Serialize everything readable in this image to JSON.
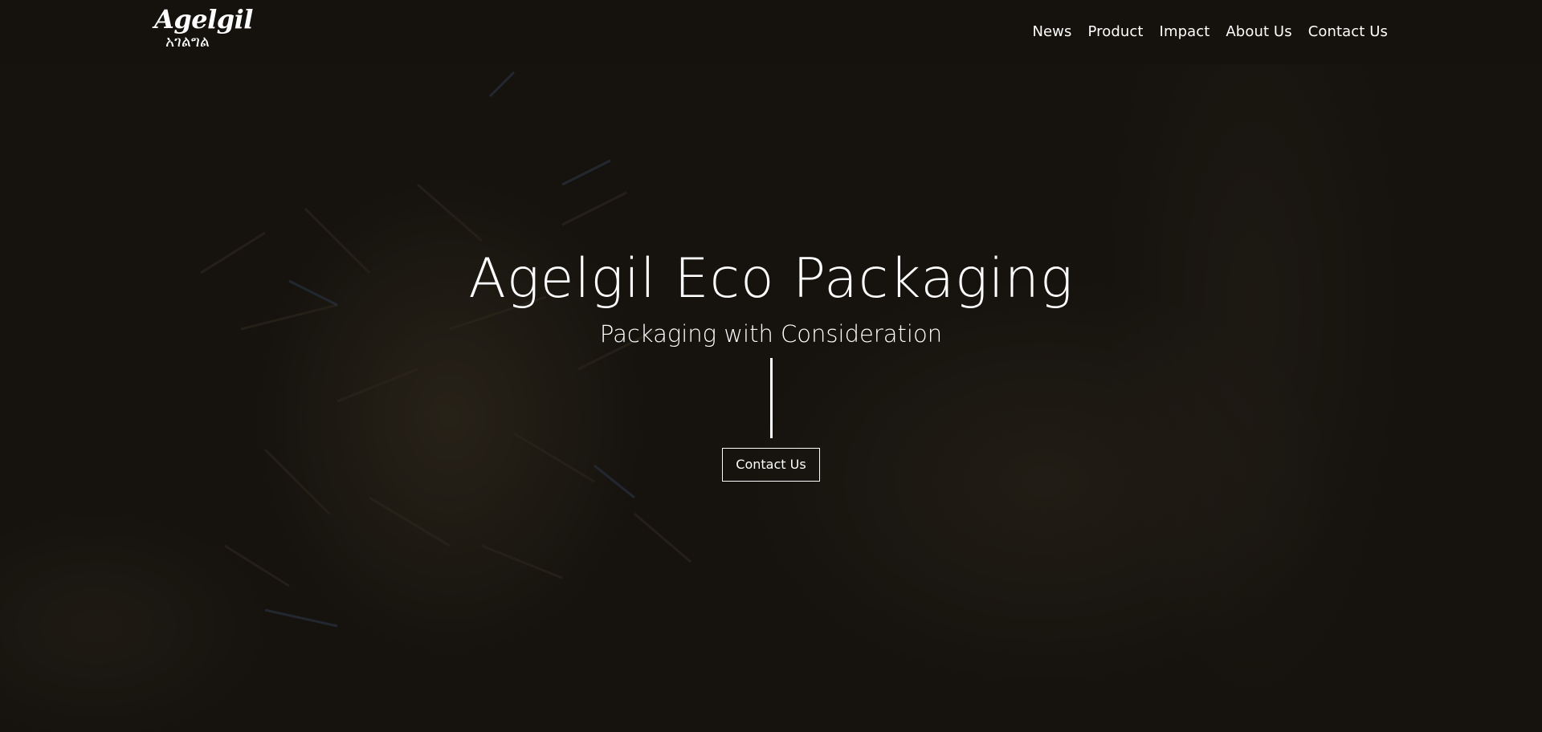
{
  "header": {
    "logo_text": "Agelgil",
    "logo_subtext": "አገልግል",
    "nav": [
      {
        "label": "News"
      },
      {
        "label": "Product"
      },
      {
        "label": "Impact"
      },
      {
        "label": "About Us"
      },
      {
        "label": "Contact Us"
      }
    ]
  },
  "hero": {
    "title": "Agelgil Eco Packaging",
    "subtitle": "Packaging with Consideration",
    "cta_label": "Contact Us"
  },
  "colors": {
    "header_background": "#15120d",
    "hero_overlay": "#1b1812",
    "text": "#ffffff"
  }
}
